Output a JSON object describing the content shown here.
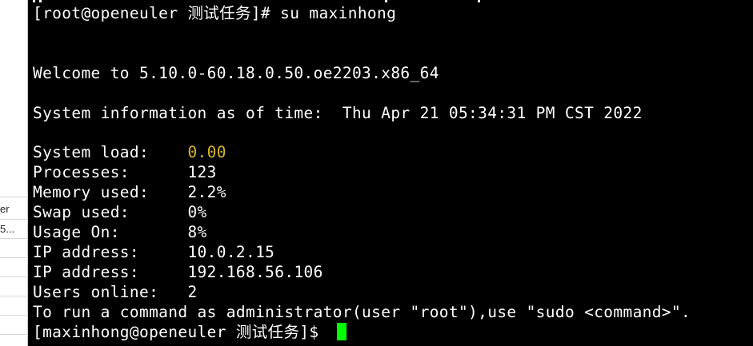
{
  "sidebar": {
    "cells": [
      "er",
      "5..."
    ]
  },
  "terminal": {
    "prompt_root": "[root@openeuler 测试任务]# su maxinhong",
    "welcome": "Welcome to 5.10.0-60.18.0.50.oe2203.x86_64",
    "sysinfo": "System information as of time:  Thu Apr 21 05:34:31 PM CST 2022",
    "stats": [
      {
        "label": "System load:    ",
        "value": "0.00",
        "highlight": "#d8b62e"
      },
      {
        "label": "Processes:      ",
        "value": "123"
      },
      {
        "label": "Memory used:    ",
        "value": "2.2%"
      },
      {
        "label": "Swap used:      ",
        "value": "0%"
      },
      {
        "label": "Usage On:       ",
        "value": "8%"
      },
      {
        "label": "IP address:     ",
        "value": "10.0.2.15"
      },
      {
        "label": "IP address:     ",
        "value": "192.168.56.106"
      },
      {
        "label": "Users online:   ",
        "value": "2"
      }
    ],
    "sudo_hint": "To run a command as administrator(user \"root\"),use \"sudo <command>\".",
    "prompt_user": "[maxinhong@openeuler 测试任务]$ "
  },
  "colors": {
    "terminal_bg": "#000000",
    "terminal_fg": "#ffffff",
    "cursor": "#00ff00",
    "highlight": "#d8b62e"
  }
}
